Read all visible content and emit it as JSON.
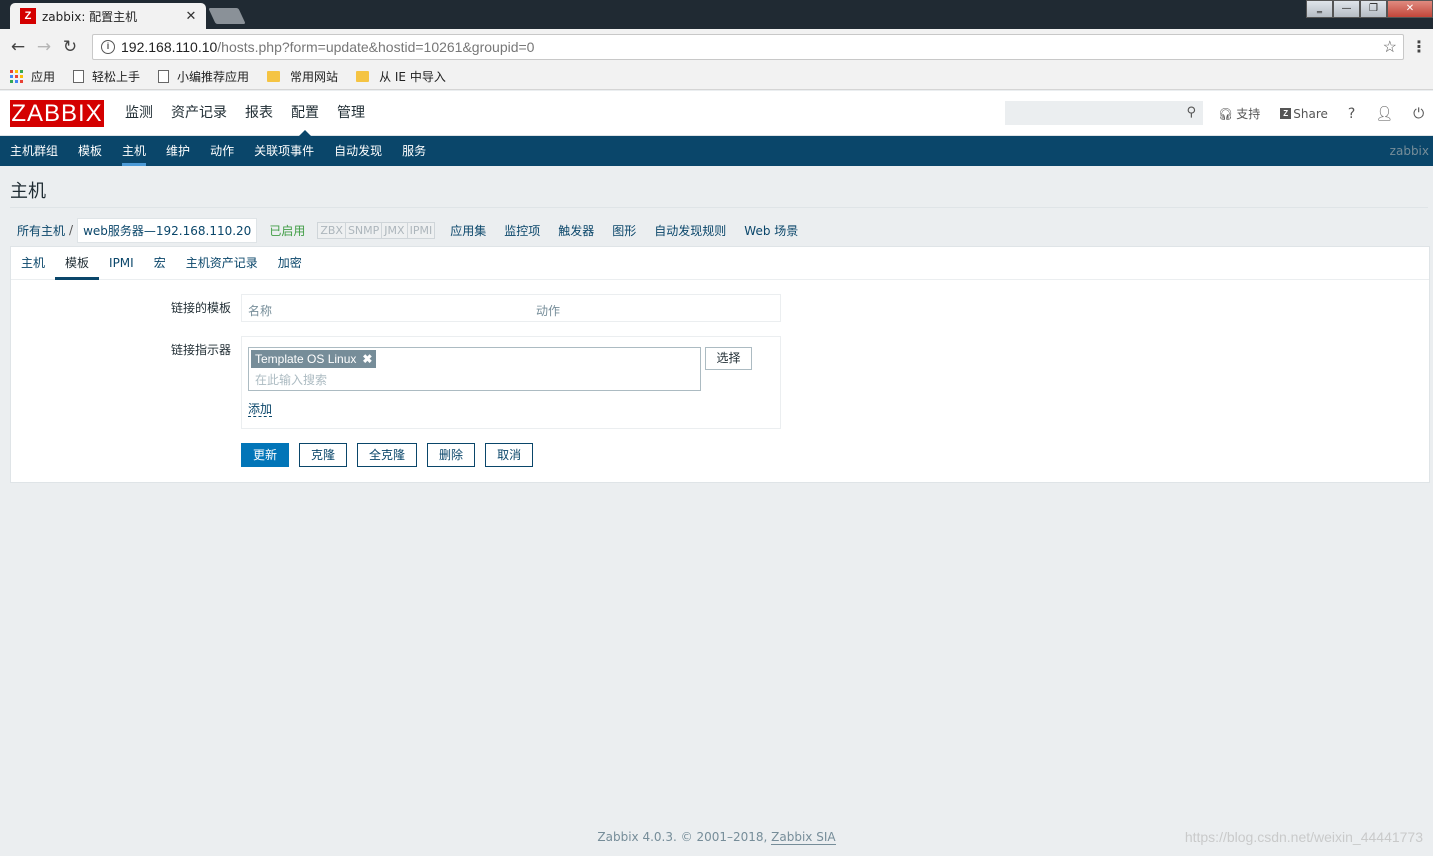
{
  "browser": {
    "tab_title": "zabbix: 配置主机",
    "tab_close": "✕",
    "url_host": "192.168.110.10",
    "url_path": "/hosts.php?form=update&hostid=10261&groupid=0",
    "bookmarks": [
      "应用",
      "轻松上手",
      "小编推荐应用",
      "常用网站",
      "从 IE 中导入"
    ]
  },
  "header": {
    "logo": "ZABBIX",
    "menu": [
      "监测",
      "资产记录",
      "报表",
      "配置",
      "管理"
    ],
    "support": "支持",
    "share": "Share",
    "help": "?"
  },
  "subnav": {
    "items": [
      "主机群组",
      "模板",
      "主机",
      "维护",
      "动作",
      "关联项事件",
      "自动发现",
      "服务"
    ],
    "user": "zabbix"
  },
  "page": {
    "title": "主机"
  },
  "host_nav": {
    "all_hosts": "所有主机",
    "current_host": "web服务器—192.168.110.20",
    "status": "已启用",
    "availability": [
      "ZBX",
      "SNMP",
      "JMX",
      "IPMI"
    ],
    "links": [
      "应用集",
      "监控项",
      "触发器",
      "图形",
      "自动发现规则",
      "Web 场景"
    ]
  },
  "form": {
    "tabs": [
      "主机",
      "模板",
      "IPMI",
      "宏",
      "主机资产记录",
      "加密"
    ],
    "linked_templates_label": "链接的模板",
    "col_name": "名称",
    "col_action": "动作",
    "link_indicator_label": "链接指示器",
    "selected_template": "Template OS Linux",
    "search_placeholder": "在此输入搜索",
    "select_button": "选择",
    "add_link": "添加",
    "buttons": [
      "更新",
      "克隆",
      "全克隆",
      "删除",
      "取消"
    ]
  },
  "footer": {
    "text": "Zabbix 4.0.3. © 2001–2018, ",
    "company": "Zabbix SIA"
  },
  "watermark": "https://blog.csdn.net/weixin_44441773"
}
